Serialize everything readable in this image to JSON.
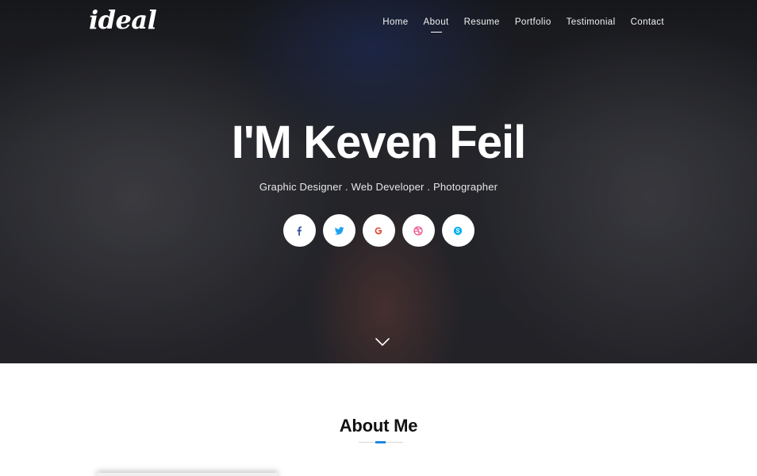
{
  "brand": {
    "logo": "ideal"
  },
  "nav": {
    "items": [
      {
        "label": "Home"
      },
      {
        "label": "About"
      },
      {
        "label": "Resume"
      },
      {
        "label": "Portfolio"
      },
      {
        "label": "Testimonial"
      },
      {
        "label": "Contact"
      }
    ],
    "active": "About"
  },
  "hero": {
    "title": "I'M Keven Feil",
    "subtitle": "Graphic Designer . Web Developer . Photographer",
    "socials": [
      {
        "icon": "facebook-icon",
        "color": "#3b5998"
      },
      {
        "icon": "twitter-icon",
        "color": "#1da1f2"
      },
      {
        "icon": "google-icon",
        "color": "#dd4b39"
      },
      {
        "icon": "dribbble-icon",
        "color": "#ea4c89"
      },
      {
        "icon": "skype-icon",
        "color": "#00aff0"
      }
    ],
    "scroll_icon": "chevron-down-icon"
  },
  "about": {
    "title": "About Me",
    "accent_color": "#1e88e5"
  }
}
